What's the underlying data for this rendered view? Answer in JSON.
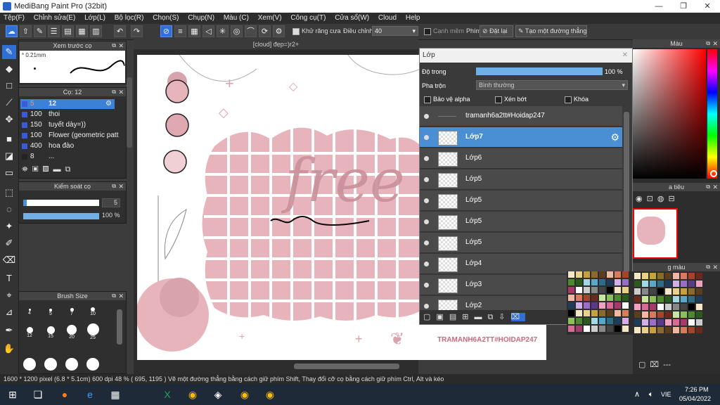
{
  "window": {
    "title": "MediBang Paint Pro (32bit)",
    "minimize": "—",
    "maximize": "❐",
    "close": "✕"
  },
  "menu": [
    "Tệp(F)",
    "Chỉnh sửa(E)",
    "Lớp(L)",
    "Bộ lọc(R)",
    "Chọn(S)",
    "Chụp(N)",
    "Màu (C)",
    "Xem(V)",
    "Công cụ(T)",
    "Cửa sổ(W)",
    "Cloud",
    "Help"
  ],
  "toolbar": {
    "antialias_label": "Khử răng cưa",
    "adjust_label": "Điều chỉnh",
    "adjust_value": "40",
    "snap_label": "Cạnh mềm",
    "key_label": "Phím",
    "reset_label": "Đặt lại",
    "line_label": "Tạo một đường thẳng"
  },
  "preview_panel": {
    "title": "Xem trước cọ",
    "size": "* 0.21mm"
  },
  "brush_panel": {
    "title": "Cọ: 12",
    "items": [
      {
        "size": "5",
        "name": "12",
        "selected": true
      },
      {
        "size": "100",
        "name": "thoi",
        "selected": false
      },
      {
        "size": "150",
        "name": "tuyết dày=))",
        "selected": false
      },
      {
        "size": "100",
        "name": "Flower (geometric patt",
        "selected": false
      },
      {
        "size": "400",
        "name": "hoa đào",
        "selected": false
      },
      {
        "size": "8",
        "name": "...",
        "selected": false
      }
    ]
  },
  "control_panel": {
    "title": "Kiểm soát cọ",
    "size_value": "5",
    "opacity_value": "100 %",
    "size_fraction": 0.05,
    "opacity_fraction": 1.0
  },
  "brush_size_panel": {
    "title": "Brush Size",
    "sizes": [
      "4",
      "5",
      "7",
      "10",
      "12",
      "15",
      "20",
      "25",
      "",
      "",
      "",
      ""
    ]
  },
  "document": {
    "tab": "[cloud] đẹp=)r2+",
    "watermark": "TRAMANH6A2TT#HOIDAP247",
    "word": "free :)"
  },
  "layer_panel": {
    "title": "Lớp",
    "opacity_label": "Độ trong",
    "opacity_value": "100 %",
    "blend_label": "Pha trộn",
    "blend_value": "Bình thường",
    "protect_alpha": "Bảo vệ alpha",
    "clip": "Xén bớt",
    "lock": "Khóa",
    "layers": [
      {
        "name": "tramanh6a2tt#Hoidap247",
        "selected": false
      },
      {
        "name": "Lớp7",
        "selected": true
      },
      {
        "name": "Lớp6",
        "selected": false
      },
      {
        "name": "Lớp5",
        "selected": false
      },
      {
        "name": "Lớp5",
        "selected": false
      },
      {
        "name": "Lớp5",
        "selected": false
      },
      {
        "name": "Lớp5",
        "selected": false
      },
      {
        "name": "Lớp4",
        "selected": false
      },
      {
        "name": "Lớp3",
        "selected": false
      },
      {
        "name": "Lớp2",
        "selected": false
      }
    ]
  },
  "right_panel": {
    "color_title": "Màu",
    "nav_title": "a tiêu",
    "palette_title": "g màu",
    "palette_footer": "---"
  },
  "status": {
    "info": "1600 * 1200 pixel  (6.8 * 5.1cm)  600 dpi  48 %  ( 695, 1195 )  Vẽ một đường thẳng bằng cách giữ phím Shift, Thay đổi cỡ cọ bằng cách giữ phím Ctrl, Alt và kéo"
  },
  "taskbar": {
    "lang": "VIE",
    "time": "7:26 PM",
    "date": "05/04/2022"
  },
  "colors": {
    "accent": "#3b82d6",
    "pink": "#e8b4bc",
    "dark": "#2d2d2d"
  }
}
